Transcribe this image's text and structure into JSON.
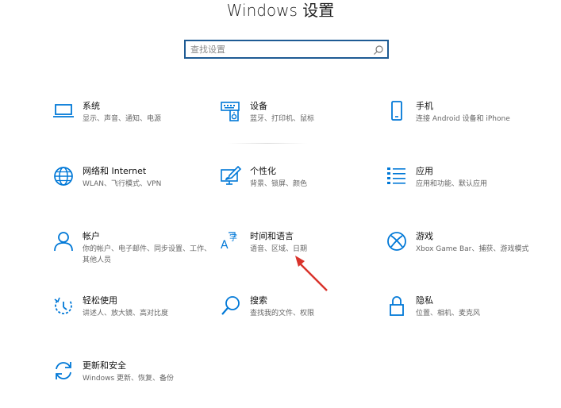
{
  "window": {
    "title": "Windows 设置"
  },
  "search": {
    "placeholder": "查找设置"
  },
  "colors": {
    "accent": "#0078d7",
    "search_border": "#1e5b94",
    "annotation_arrow": "#d9332b"
  },
  "tiles": [
    {
      "title": "系统",
      "desc": "显示、声音、通知、电源",
      "icon": "laptop-icon"
    },
    {
      "title": "设备",
      "desc": "蓝牙、打印机、鼠标",
      "icon": "keyboard-speaker-icon"
    },
    {
      "title": "手机",
      "desc": "连接 Android 设备和 iPhone",
      "icon": "phone-icon"
    },
    {
      "title": "网络和 Internet",
      "desc": "WLAN、飞行模式、VPN",
      "icon": "globe-icon"
    },
    {
      "title": "个性化",
      "desc": "背景、锁屏、颜色",
      "icon": "paint-monitor-icon"
    },
    {
      "title": "应用",
      "desc": "应用和功能、默认应用",
      "icon": "apps-list-icon"
    },
    {
      "title": "帐户",
      "desc": "你的帐户、电子邮件、同步设置、工作、其他人员",
      "icon": "person-icon"
    },
    {
      "title": "时间和语言",
      "desc": "语音、区域、日期",
      "icon": "time-language-icon"
    },
    {
      "title": "游戏",
      "desc": "Xbox Game Bar、捕获、游戏模式",
      "icon": "xbox-icon"
    },
    {
      "title": "轻松使用",
      "desc": "讲述人、放大镜、高对比度",
      "icon": "ease-of-access-icon"
    },
    {
      "title": "搜索",
      "desc": "查找我的文件、权限",
      "icon": "magnifier-icon"
    },
    {
      "title": "隐私",
      "desc": "位置、相机、麦克风",
      "icon": "lock-icon"
    },
    {
      "title": "更新和安全",
      "desc": "Windows 更新、恢复、备份",
      "icon": "sync-icon"
    }
  ]
}
